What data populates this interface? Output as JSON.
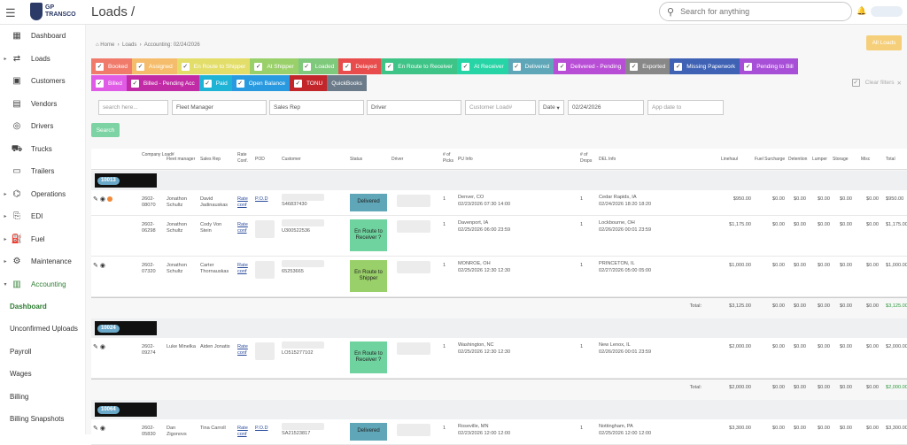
{
  "header": {
    "logo_text_1": "GP",
    "logo_text_2": "TRANSCO",
    "page_title": "Loads /",
    "search_placeholder": "Search for anything"
  },
  "sidebar": {
    "items": [
      {
        "label": "Dashboard",
        "icon": "dashboard-icon",
        "caret": false
      },
      {
        "label": "Loads",
        "icon": "loads-icon",
        "caret": true
      },
      {
        "label": "Customers",
        "icon": "customers-icon",
        "caret": false
      },
      {
        "label": "Vendors",
        "icon": "vendors-icon",
        "caret": false
      },
      {
        "label": "Drivers",
        "icon": "drivers-icon",
        "caret": false
      },
      {
        "label": "Trucks",
        "icon": "truck-icon",
        "caret": false
      },
      {
        "label": "Trailers",
        "icon": "trailer-icon",
        "caret": false
      },
      {
        "label": "Operations",
        "icon": "operations-icon",
        "caret": true
      },
      {
        "label": "EDI",
        "icon": "edi-icon",
        "caret": true
      },
      {
        "label": "Fuel",
        "icon": "fuel-icon",
        "caret": true
      },
      {
        "label": "Maintenance",
        "icon": "maintenance-icon",
        "caret": true
      },
      {
        "label": "Accounting",
        "icon": "accounting-icon",
        "caret": true
      }
    ],
    "sub_items": [
      "Dashboard",
      "Unconfirmed Uploads",
      "Payroll",
      "Wages",
      "Billing",
      "Billing Snapshots"
    ]
  },
  "breadcrumb": {
    "home": "Home",
    "loads": "Loads",
    "current": "Accounting: 02/24/2026"
  },
  "all_loads_button": "All Loads",
  "status_chips_row1": [
    {
      "label": "Booked",
      "color": "#f07b6b"
    },
    {
      "label": "Assigned",
      "color": "#f5bd6b"
    },
    {
      "label": "En Route to Shipper",
      "color": "#e3de6a"
    },
    {
      "label": "At Shipper",
      "color": "#9ad06a"
    },
    {
      "label": "Loaded",
      "color": "#7fc97d"
    },
    {
      "label": "Delayed",
      "color": "#e84c4c"
    },
    {
      "label": "En Route to Receiver",
      "color": "#3fc487"
    },
    {
      "label": "At Receiver",
      "color": "#27d4a6"
    },
    {
      "label": "Delivered",
      "color": "#5fa7b8"
    },
    {
      "label": "Delivered - Pending",
      "color": "#b94ed6"
    },
    {
      "label": "Exported",
      "color": "#888888"
    },
    {
      "label": "Missing Paperwork",
      "color": "#3f62b5"
    },
    {
      "label": "Pending to Bill",
      "color": "#a84fd8"
    }
  ],
  "status_chips_row2": [
    {
      "label": "Billed",
      "color": "#e05be6"
    },
    {
      "label": "Billed - Pending Acc",
      "color": "#c12ba6"
    },
    {
      "label": "Paid",
      "color": "#1fb3d6"
    },
    {
      "label": "Open Balance",
      "color": "#2a9ae0"
    },
    {
      "label": "TONU",
      "color": "#c2262b"
    },
    {
      "label": "QuickBooks",
      "color": "#6b7b8a"
    }
  ],
  "clear_filters": "Clear filters",
  "filters": {
    "search": "search here...",
    "fleet_manager": "Fleet Manager",
    "sales_rep": "Sales Rep",
    "driver": "Driver",
    "customer_load": "Customer Load#",
    "date_select": "Date",
    "date_value": "02/24/2026",
    "app_date": "App date to"
  },
  "search_button": "Search",
  "columns": [
    "Company Load#",
    "Fleet manager",
    "Sales Rep",
    "Rate Conf.",
    "POD",
    "Customer",
    "Status",
    "Driver",
    "# of Picks",
    "PU Info",
    "# of Drops",
    "DEL Info",
    "Linehaul",
    "Fuel Surcharge",
    "Detention",
    "Lumper",
    "Storage",
    "Misc",
    "Total"
  ],
  "groups": [
    {
      "id": "10013",
      "rows": [
        {
          "load": "2602-08070",
          "fm": "Jonathon Schultz",
          "sales": "David Jadinauskas",
          "rate": "Rate conf",
          "pod": "P.O.D",
          "customer": "S46837430",
          "status": "Delivered",
          "status_class": "st-delivered",
          "picks": "1",
          "pu": "Denver, CO",
          "pu_date": "02/23/2026 07:30 14:00",
          "drops": "1",
          "del": "Cedar Rapids, IA",
          "del_date": "02/24/2026 18:20 18:20",
          "linehaul": "$950.00",
          "fuel": "$0.00",
          "det": "$0.00",
          "lump": "$0.00",
          "stor": "$0.00",
          "misc": "$0.00",
          "total": "$950.00",
          "edit_icons": true,
          "flame": true
        },
        {
          "load": "2602-06298",
          "fm": "Jonathon Schultz",
          "sales": "Cody Von Stein",
          "rate": "Rate conf",
          "pod": "",
          "customer": "U300522536",
          "status": "En Route to Receiver ?",
          "status_class": "st-route",
          "picks": "1",
          "pu": "Davenport, IA",
          "pu_date": "02/25/2026 06:00 23:59",
          "drops": "1",
          "del": "Lockbourne, OH",
          "del_date": "02/26/2026 00:01 23:59",
          "linehaul": "$1,175.00",
          "fuel": "$0.00",
          "det": "$0.00",
          "lump": "$0.00",
          "stor": "$0.00",
          "misc": "$0.00",
          "total": "$1,175.00",
          "edit_icons": false,
          "flame": false
        },
        {
          "load": "2602-07320",
          "fm": "Jonathon Schultz",
          "sales": "Carter Thornauskas",
          "rate": "Rate conf",
          "pod": "",
          "customer": "65253665",
          "status": "En Route to Shipper",
          "status_class": "st-shipper",
          "picks": "1",
          "pu": "MONROE, OH",
          "pu_date": "02/25/2026 12:30 12:30",
          "drops": "1",
          "del": "PRINCETON, IL",
          "del_date": "02/27/2026 05:00 05:00",
          "linehaul": "$1,000.00",
          "fuel": "$0.00",
          "det": "$0.00",
          "lump": "$0.00",
          "stor": "$0.00",
          "misc": "$0.00",
          "total": "$1,000.00",
          "edit_icons": true,
          "flame": false
        }
      ],
      "total_label": "Total:",
      "total_linehaul": "$3,125.00",
      "total_fuel": "$0.00",
      "total_det": "$0.00",
      "total_lump": "$0.00",
      "total_stor": "$0.00",
      "total_misc": "$0.00",
      "total_all": "$3,125.00"
    },
    {
      "id": "10024",
      "rows": [
        {
          "load": "2602-09274",
          "fm": "Luke Minelka",
          "sales": "Aiden Jonatis",
          "rate": "Rate conf",
          "pod": "",
          "customer": "LO515277102",
          "status": "En Route to Receiver ?",
          "status_class": "st-route",
          "picks": "1",
          "pu": "Washington, NC",
          "pu_date": "02/25/2026 12:30 12:30",
          "drops": "1",
          "del": "New Lenox, IL",
          "del_date": "02/26/2026 00:01 23:59",
          "linehaul": "$2,000.00",
          "fuel": "$0.00",
          "det": "$0.00",
          "lump": "$0.00",
          "stor": "$0.00",
          "misc": "$0.00",
          "total": "$2,000.00",
          "edit_icons": true,
          "flame": false
        }
      ],
      "total_label": "Total:",
      "total_linehaul": "$2,000.00",
      "total_fuel": "$0.00",
      "total_det": "$0.00",
      "total_lump": "$0.00",
      "total_stor": "$0.00",
      "total_misc": "$0.00",
      "total_all": "$2,000.00"
    },
    {
      "id": "10064",
      "rows": [
        {
          "load": "2602-05830",
          "fm": "Dan Zigonovs",
          "sales": "Tina Carroll",
          "rate": "Rate conf",
          "pod": "P.O.D",
          "customer": "SA21523817",
          "status": "Delivered",
          "status_class": "st-delivered",
          "picks": "1",
          "pu": "Roseville, MN",
          "pu_date": "02/23/2026 12:00 12:00",
          "drops": "1",
          "del": "Nottingham, PA",
          "del_date": "02/25/2026 12:00 12:00",
          "linehaul": "$3,300.00",
          "fuel": "$0.00",
          "det": "$0.00",
          "lump": "$0.00",
          "stor": "$0.00",
          "misc": "$0.00",
          "total": "$3,300.00",
          "edit_icons": true,
          "flame": false
        }
      ]
    }
  ]
}
